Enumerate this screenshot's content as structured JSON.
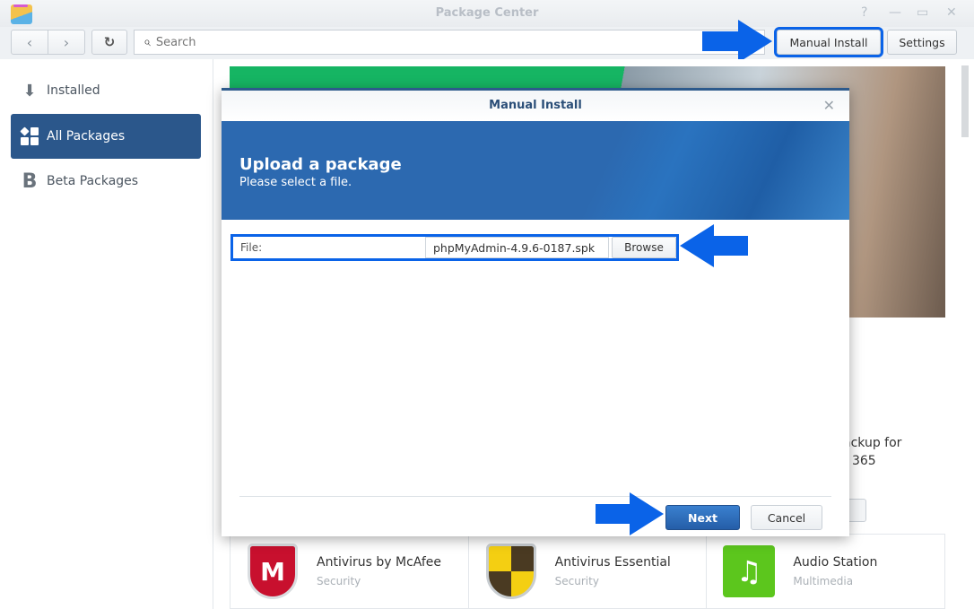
{
  "window": {
    "title": "Package Center",
    "controls": [
      "help-icon",
      "minimize-icon",
      "maximize-icon",
      "close-icon"
    ]
  },
  "toolbar": {
    "back_icon": "‹",
    "forward_icon": "›",
    "refresh_icon": "↻",
    "search_placeholder": "Search",
    "search_icon": "⌕",
    "manual_install_label": "Manual Install",
    "settings_label": "Settings"
  },
  "sidebar": {
    "items": [
      {
        "label": "Installed",
        "icon": "download-icon",
        "active": false
      },
      {
        "label": "All Packages",
        "icon": "grid-icon",
        "active": true
      },
      {
        "label": "Beta Packages",
        "icon": "beta-icon",
        "active": false
      }
    ]
  },
  "dialog": {
    "title": "Manual Install",
    "close_icon": "✕",
    "heading": "Upload a package",
    "subheading": "Please select a file.",
    "file_label": "File:",
    "file_value": "phpMyAdmin-4.9.6-0187.spk",
    "browse_label": "Browse",
    "next_label": "Next",
    "cancel_label": "Cancel"
  },
  "packages": [
    {
      "name": "Antivirus by McAfee",
      "category": "Security",
      "icon_glyph": "M"
    },
    {
      "name": "Antivirus Essential",
      "category": "Security",
      "icon_glyph": ""
    },
    {
      "name": "Audio Station",
      "category": "Multimedia",
      "icon_glyph": "♫"
    }
  ],
  "partial_card": {
    "line1": "ackup for",
    "line2": "t 365"
  },
  "annotation_color": "#0a63e8"
}
